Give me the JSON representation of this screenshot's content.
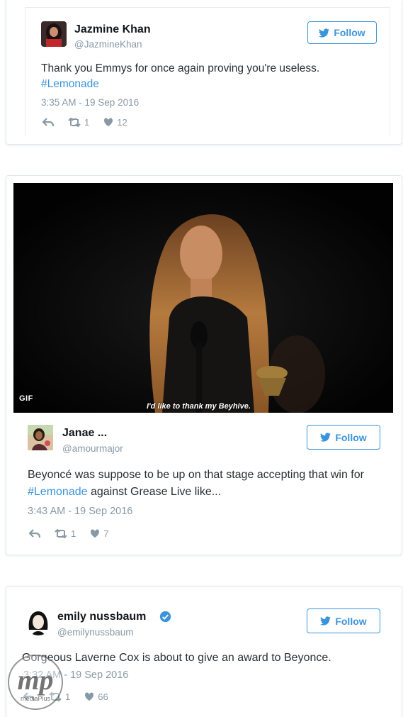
{
  "tweets": [
    {
      "name": "Jazmine Khan",
      "handle": "@JazmineKhan",
      "follow_label": "Follow",
      "text": "Thank you Emmys for once again proving you're useless.",
      "hashtag": "#Lemonade",
      "time": "3:35 AM - 19 Sep 2016",
      "retweets": "1",
      "likes": "12"
    },
    {
      "name": "Janae ...",
      "handle": "@amourmajor",
      "follow_label": "Follow",
      "text_before": "Beyoncé was suppose to be up on that stage accepting that win for",
      "hashtag": "#Lemonade",
      "text_after": "against Grease Live like...",
      "time": "3:43 AM - 19 Sep 2016",
      "retweets": "1",
      "likes": "7",
      "media": {
        "badge": "GIF",
        "caption": "I'd like to thank my Beyhive."
      }
    },
    {
      "name": "emily nussbaum",
      "handle": "@emilynussbaum",
      "follow_label": "Follow",
      "verified": true,
      "text": "Gorgeous Laverne Cox is about to give an award to Beyonce.",
      "time": "3:32 AM - 19 Sep 2016",
      "retweets": "1",
      "likes": "66"
    }
  ],
  "watermark": {
    "logo_text": "mp",
    "sub_text": "mediaPlus"
  },
  "colors": {
    "link": "#3b94d9",
    "muted": "#8899a6",
    "text": "#292f33",
    "border": "#e1e8ed"
  }
}
